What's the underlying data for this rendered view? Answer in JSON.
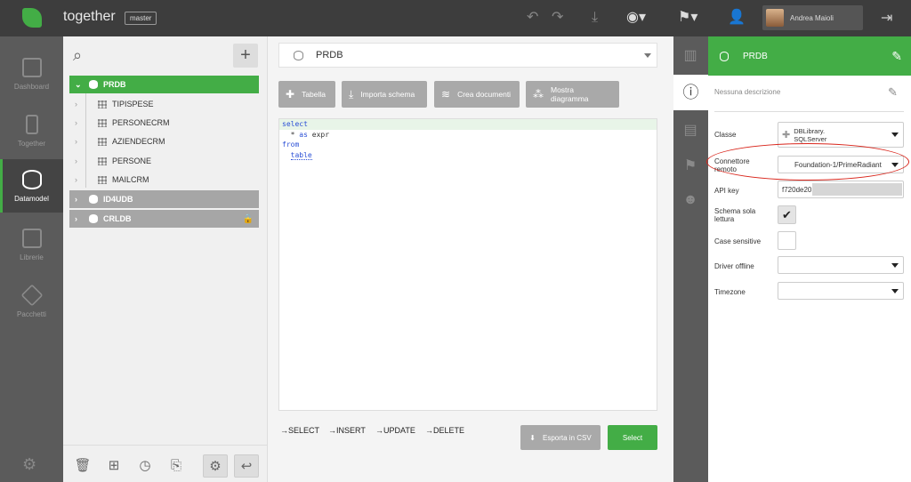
{
  "app": {
    "name": "together",
    "branch": "master",
    "user": "Andrea Maioli"
  },
  "leftnav": [
    {
      "label": "Dashboard",
      "icon": "dashboard-icon"
    },
    {
      "label": "Together",
      "icon": "phone-icon"
    },
    {
      "label": "Datamodel",
      "icon": "database-icon"
    },
    {
      "label": "Librerie",
      "icon": "book-icon"
    },
    {
      "label": "Pacchetti",
      "icon": "package-icon"
    }
  ],
  "tree": {
    "root": "PRDB",
    "tables": [
      "TIPISPESE",
      "PERSONECRM",
      "AZIENDECRM",
      "PERSONE",
      "MAILCRM"
    ],
    "others": [
      "ID4UDB",
      "CRLDB"
    ]
  },
  "main": {
    "db_selected": "PRDB",
    "actions": [
      "Tabella",
      "Importa schema",
      "Crea documenti",
      "Mostra diagramma"
    ],
    "editor": {
      "kw_select": "select",
      "star": "*",
      "kw_as": "as",
      "expr": "expr",
      "kw_from": "from",
      "table": "table"
    },
    "statements": [
      "→SELECT",
      "→INSERT",
      "→UPDATE",
      "→DELETE"
    ],
    "export_label": "Esporta in CSV",
    "select_label": "Select"
  },
  "panel": {
    "title": "PRDB",
    "description": "Nessuna descrizione",
    "classe_label": "Classe",
    "classe_value_1": "DBLibrary.",
    "classe_value_2": "SQLServer",
    "connettore_label_1": "Connettore",
    "connettore_label_2": "remoto",
    "connettore_value": "Foundation-1/PrimeRadiant",
    "apikey_label": "API key",
    "apikey_value": "f720de20",
    "schema_label_1": "Schema sola",
    "schema_label_2": "lettura",
    "schema_checked": true,
    "case_label": "Case sensitive",
    "driver_label": "Driver offline",
    "timezone_label": "Timezone"
  },
  "colors": {
    "accent": "#43ad46",
    "highlight": "#d9261c"
  }
}
